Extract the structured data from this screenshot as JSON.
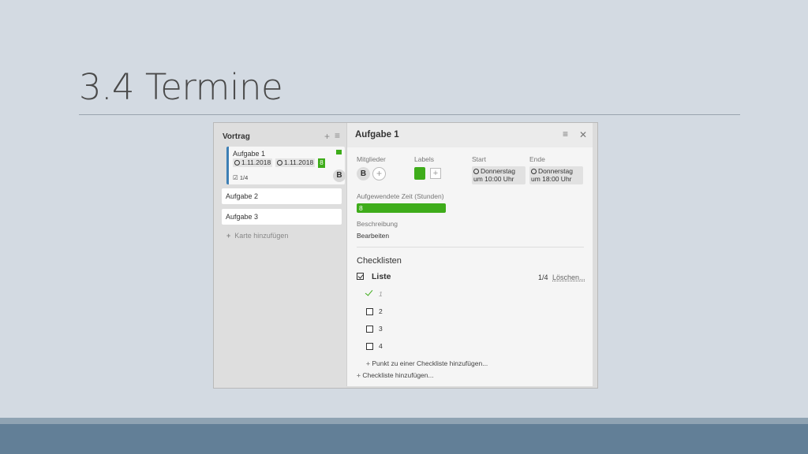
{
  "slide": {
    "title": "3.4 Termine"
  },
  "list": {
    "title": "Vortrag",
    "add_icon": "plus-icon",
    "menu_icon": "hamburger-icon",
    "cards": [
      {
        "title": "Aufgabe 1",
        "start": "1.11.2018",
        "end": "1.11.2018",
        "count": "8",
        "checklist": "1/4",
        "member": "B",
        "label_color": "#3eac1a"
      },
      {
        "title": "Aufgabe 2"
      },
      {
        "title": "Aufgabe 3"
      }
    ],
    "add_card": "Karte hinzufügen"
  },
  "detail": {
    "title": "Aufgabe 1",
    "members_label": "Mitglieder",
    "member_initial": "B",
    "labels_label": "Labels",
    "start_label": "Start",
    "start_value": "Donnerstag um 10:00 Uhr",
    "start_day": "Donnerstag",
    "start_time": "um 10:00 Uhr",
    "end_label": "Ende",
    "end_day": "Donnerstag",
    "end_time": "um 18:00 Uhr",
    "time_spent_label": "Aufgewendete Zeit (Stunden)",
    "time_spent": "8",
    "description_label": "Beschreibung",
    "description_edit": "Bearbeiten",
    "checklists_title": "Checklisten",
    "checklist": {
      "name": "Liste",
      "progress": "1/4",
      "delete": "Löschen...",
      "items": [
        {
          "text": "1",
          "done": true
        },
        {
          "text": "2",
          "done": false
        },
        {
          "text": "3",
          "done": false
        },
        {
          "text": "4",
          "done": false
        }
      ],
      "add_item": "Punkt zu einer Checkliste hinzufügen..."
    },
    "add_checklist": "Checkliste hinzufügen..."
  },
  "colors": {
    "accent_green": "#3eac1a",
    "card_border": "#3d7fb5",
    "footer": "#627f97"
  }
}
